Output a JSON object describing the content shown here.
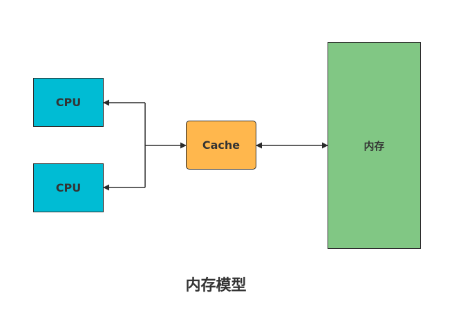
{
  "nodes": {
    "cpu_top": "CPU",
    "cpu_bottom": "CPU",
    "cache": "Cache",
    "memory": "内存"
  },
  "caption": "内存模型",
  "colors": {
    "cpu": "#00bcd4",
    "cache": "#ffb74d",
    "memory": "#81c784",
    "line": "#2b2b2b"
  }
}
